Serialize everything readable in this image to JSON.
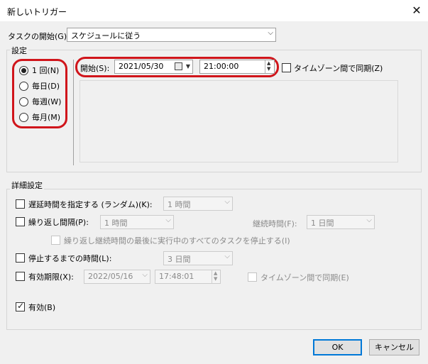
{
  "window": {
    "title": "新しいトリガー",
    "close_glyph": "✕"
  },
  "task_start": {
    "label": "タスクの開始(G):",
    "value": "スケジュールに従う"
  },
  "settings": {
    "legend": "設定",
    "radios": [
      {
        "label": "1 回(N)",
        "checked": true
      },
      {
        "label": "毎日(D)",
        "checked": false
      },
      {
        "label": "毎週(W)",
        "checked": false
      },
      {
        "label": "毎月(M)",
        "checked": false
      }
    ],
    "start_label": "開始(S):",
    "start_date": "2021/05/30",
    "start_time": "21:00:00",
    "sync_label": "タイムゾーン間で同期(Z)"
  },
  "advanced": {
    "legend": "詳細設定",
    "delay": {
      "label": "遅延時間を指定する (ランダム)(K):",
      "value": "1 時間"
    },
    "repeat": {
      "label": "繰り返し間隔(P):",
      "value": "1 時間",
      "duration_label": "継続時間(F):",
      "duration_value": "1 日間"
    },
    "stop_all": {
      "label": "繰り返し継続時間の最後に実行中のすべてのタスクを停止する(I)"
    },
    "stop_after": {
      "label": "停止するまでの時間(L):",
      "value": "3 日間"
    },
    "expire": {
      "label": "有効期限(X):",
      "date": "2022/05/16",
      "time": "17:48:01",
      "sync_label": "タイムゾーン間で同期(E)"
    },
    "enabled": {
      "label": "有効(B)",
      "checked": true
    }
  },
  "buttons": {
    "ok": "OK",
    "cancel": "キャンセル"
  }
}
